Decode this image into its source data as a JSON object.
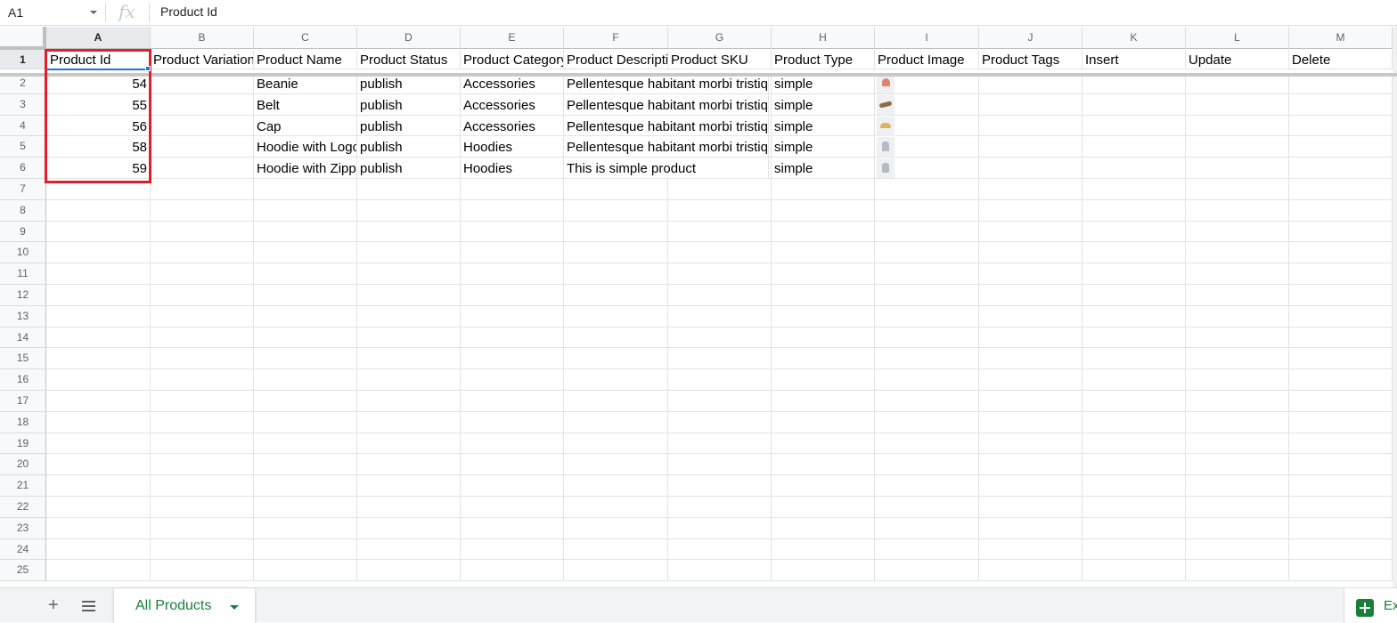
{
  "formula_bar": {
    "cell_ref": "A1",
    "fx_label": "fx",
    "content": "Product Id"
  },
  "columns": [
    "A",
    "B",
    "C",
    "D",
    "E",
    "F",
    "G",
    "H",
    "I",
    "J",
    "K",
    "L",
    "M"
  ],
  "rows": [
    "1",
    "2",
    "3",
    "4",
    "5",
    "6",
    "7",
    "8",
    "9",
    "10",
    "11",
    "12",
    "13",
    "14",
    "15",
    "16",
    "17",
    "18",
    "19",
    "20",
    "21",
    "22",
    "23",
    "24",
    "25"
  ],
  "headers": [
    "Product Id",
    "Product Variation",
    "Product Name",
    "Product Status",
    "Product Category",
    "Product Description",
    "Product SKU",
    "Product Type",
    "Product Image",
    "Product Tags",
    "Insert",
    "Update",
    "Delete"
  ],
  "data_rows": [
    {
      "id": "54",
      "name": "Beanie",
      "status": "publish",
      "category": "Accessories",
      "description": "Pellentesque habitant morbi tristique",
      "type": "simple",
      "image": "beanie-thumbnail"
    },
    {
      "id": "55",
      "name": "Belt",
      "status": "publish",
      "category": "Accessories",
      "description": "Pellentesque habitant morbi tristique",
      "type": "simple",
      "image": "belt-thumbnail"
    },
    {
      "id": "56",
      "name": "Cap",
      "status": "publish",
      "category": "Accessories",
      "description": "Pellentesque habitant morbi tristique",
      "type": "simple",
      "image": "cap-thumbnail"
    },
    {
      "id": "58",
      "name": "Hoodie with Logo",
      "status": "publish",
      "category": "Hoodies",
      "description": "Pellentesque habitant morbi tristique",
      "type": "simple",
      "image": "hoodie-thumbnail"
    },
    {
      "id": "59",
      "name": "Hoodie with Zipper",
      "status": "publish",
      "category": "Hoodies",
      "description": "This is simple product",
      "type": "simple",
      "image": "hoodie-thumbnail"
    }
  ],
  "sheet_tabs": {
    "add_icon": "+",
    "list_icon": "sheet-list-icon",
    "active_tab": "All Products",
    "explore_label": "Ex"
  },
  "colors": {
    "selection_border": "#e21e2a",
    "active_cell": "#1a73e8",
    "sheet_tab_text": "#188038"
  }
}
